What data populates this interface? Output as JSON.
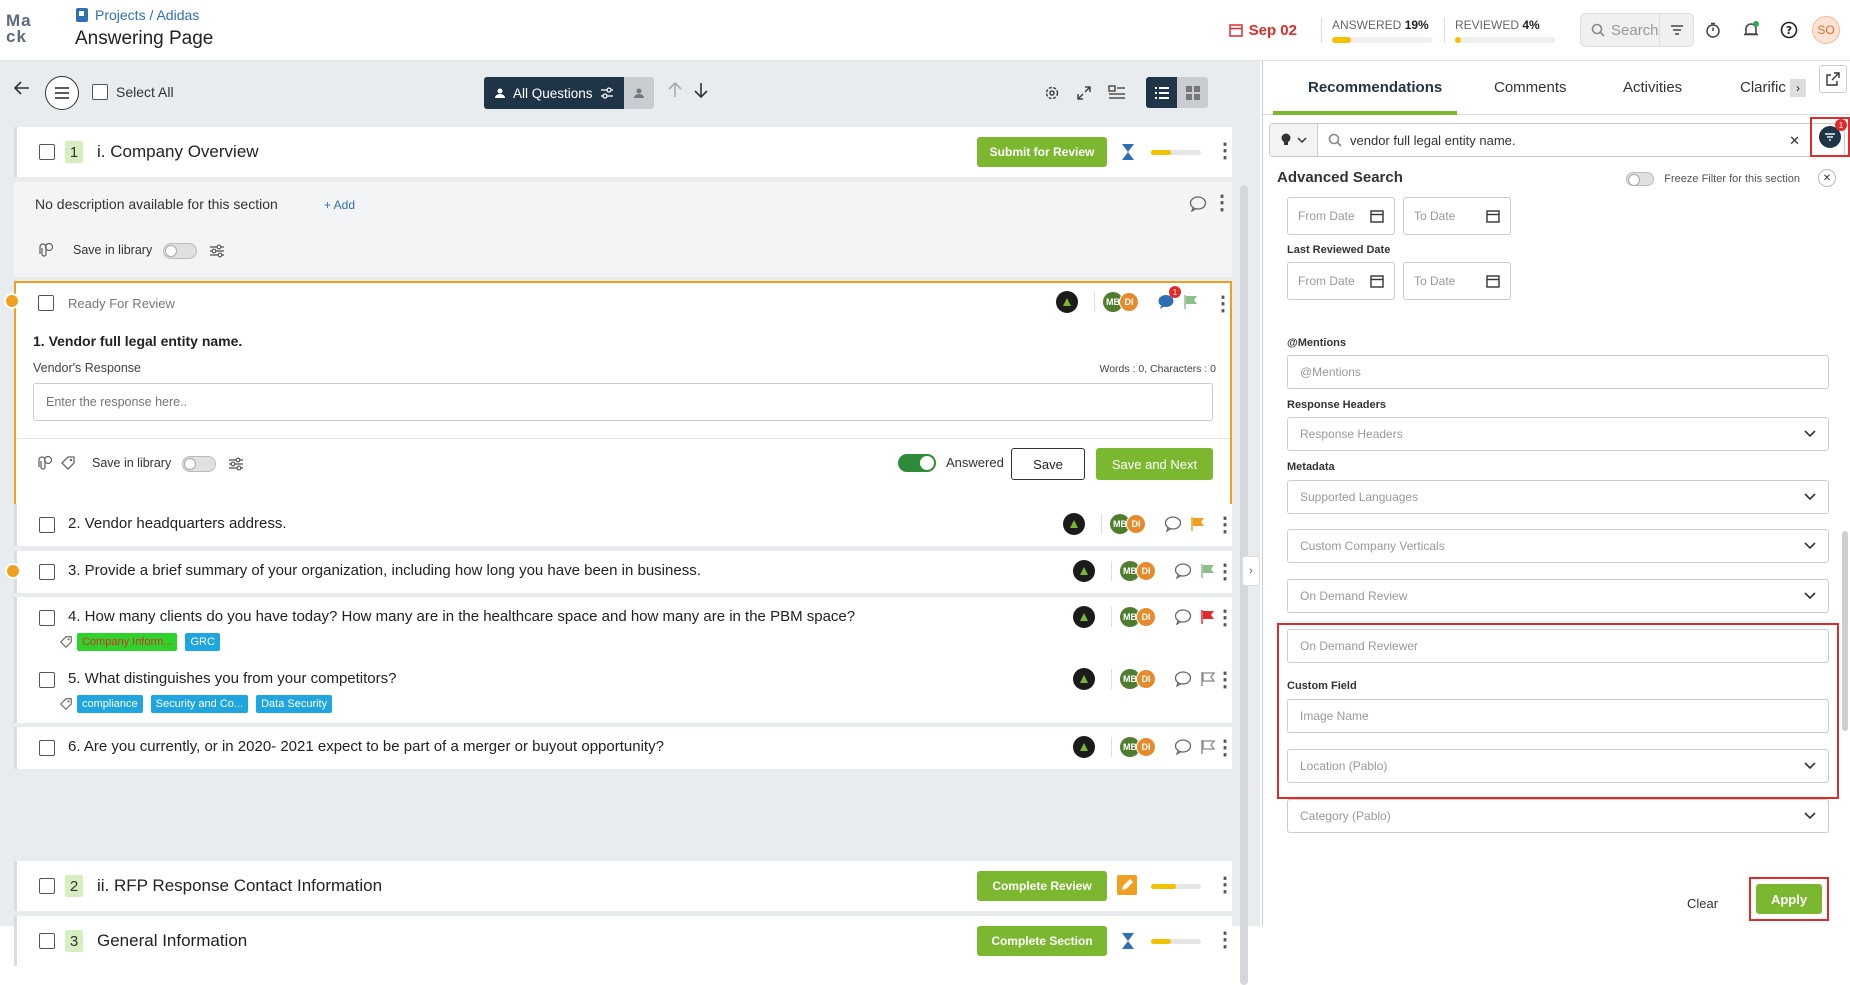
{
  "header": {
    "logo_line1": "Ma",
    "logo_line2": "ck",
    "breadcrumb": "Projects / Adidas",
    "title": "Answering Page",
    "due_date": "Sep 02",
    "answered_label": "ANSWERED",
    "answered_pct": "19%",
    "answered_progress": 0.19,
    "reviewed_label": "REVIEWED",
    "reviewed_pct": "4%",
    "reviewed_progress": 0.04,
    "search_placeholder": "Search",
    "avatar_initials": "SO"
  },
  "toolbar": {
    "select_all": "Select All",
    "filter_label": "All Questions"
  },
  "sections": [
    {
      "num": "1",
      "title": "i. Company Overview",
      "button": "Submit for Review"
    },
    {
      "num": "2",
      "title": "ii. RFP Response Contact Information",
      "button": "Complete Review"
    },
    {
      "num": "3",
      "title": "General Information",
      "button": "Complete Section"
    }
  ],
  "section1": {
    "no_desc": "No description available for this section",
    "add": "+ Add",
    "save_library": "Save in library"
  },
  "active_question": {
    "status": "Ready For Review",
    "comment_badge": "1",
    "title": "1. Vendor full legal entity name.",
    "response_label": "Vendor's Response",
    "counter": "Words : 0, Characters : 0",
    "placeholder": "Enter the response here..",
    "save_library": "Save in library",
    "answered": "Answered",
    "save": "Save",
    "save_next": "Save and Next"
  },
  "questions": [
    {
      "text": "2. Vendor headquarters address."
    },
    {
      "text": "3. Provide a brief summary of your organization, including how long you have been in business."
    },
    {
      "text": "4. How many clients do you have today? How many are in the healthcare space and how many are in the PBM space?",
      "tags": [
        "Company Inform...",
        "GRC"
      ]
    },
    {
      "text": "5. What distinguishes you from your competitors?",
      "tags": [
        "compliance",
        "Security and Co...",
        "Data Security"
      ]
    },
    {
      "text": "6. Are you currently, or in 2020- 2021 expect to be part of a merger or buyout opportunity?"
    }
  ],
  "avatars": {
    "mb": "MB",
    "di": "DI"
  },
  "panel": {
    "tabs": [
      "Recommendations",
      "Comments",
      "Activities",
      "Clarific"
    ],
    "search_value": "vendor full legal entity name.",
    "filter_badge": "1",
    "adv_title": "Advanced Search",
    "freeze_label": "Freeze Filter for this section",
    "from_date": "From Date",
    "to_date": "To Date",
    "last_reviewed": "Last Reviewed Date",
    "mentions_label": "@Mentions",
    "mentions_placeholder": "@Mentions",
    "response_headers_label": "Response Headers",
    "response_headers_placeholder": "Response Headers",
    "metadata_label": "Metadata",
    "supported_languages": "Supported Languages",
    "custom_verticals": "Custom Company Verticals",
    "on_demand_review": "On Demand Review",
    "on_demand_reviewer": "On Demand Reviewer",
    "custom_field_label": "Custom Field",
    "image_name": "Image Name",
    "location": "Location (Pablo)",
    "category": "Category (Pablo)",
    "clear": "Clear",
    "apply": "Apply"
  },
  "colors": {
    "accent_green": "#7cb82f",
    "navy": "#1f3447",
    "danger": "#e02b2b",
    "warning": "#f0a020"
  }
}
